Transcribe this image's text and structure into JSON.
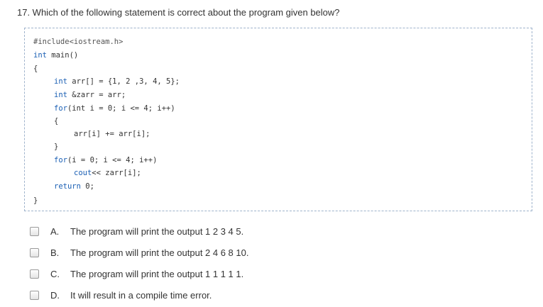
{
  "question": {
    "text": "17. Which of the following statement is correct about the program given below?"
  },
  "code": {
    "line1": "#include<iostream.h>",
    "line2_kw": "int",
    "line2_rest": " main()",
    "line3": "{",
    "line4_kw": "int",
    "line4_rest": " arr[] = {1, 2 ,3, 4, 5};",
    "line5_kw": "int",
    "line5_rest": " &zarr = arr;",
    "line6_kw": "for",
    "line6_rest": "(int i = 0; i <= 4; i++)",
    "line7": "{",
    "line8": "arr[i] += arr[i];",
    "line9": "}",
    "line10_kw": "for",
    "line10_rest": "(i = 0; i <= 4; i++)",
    "line11_kw": "cout",
    "line11_rest": "<< zarr[i];",
    "line12_kw": "return",
    "line12_rest": " 0;",
    "line13": "}"
  },
  "options": [
    {
      "letter": "A.",
      "text": "The program will print the output 1 2 3 4 5."
    },
    {
      "letter": "B.",
      "text": "The program will print the output 2 4 6 8 10."
    },
    {
      "letter": "C.",
      "text": "The program will print the output 1 1 1 1 1."
    },
    {
      "letter": "D.",
      "text": "It will result in a compile time error."
    }
  ],
  "colors": {
    "keyword": "#1a5fb4",
    "border": "#9fb3cc"
  }
}
